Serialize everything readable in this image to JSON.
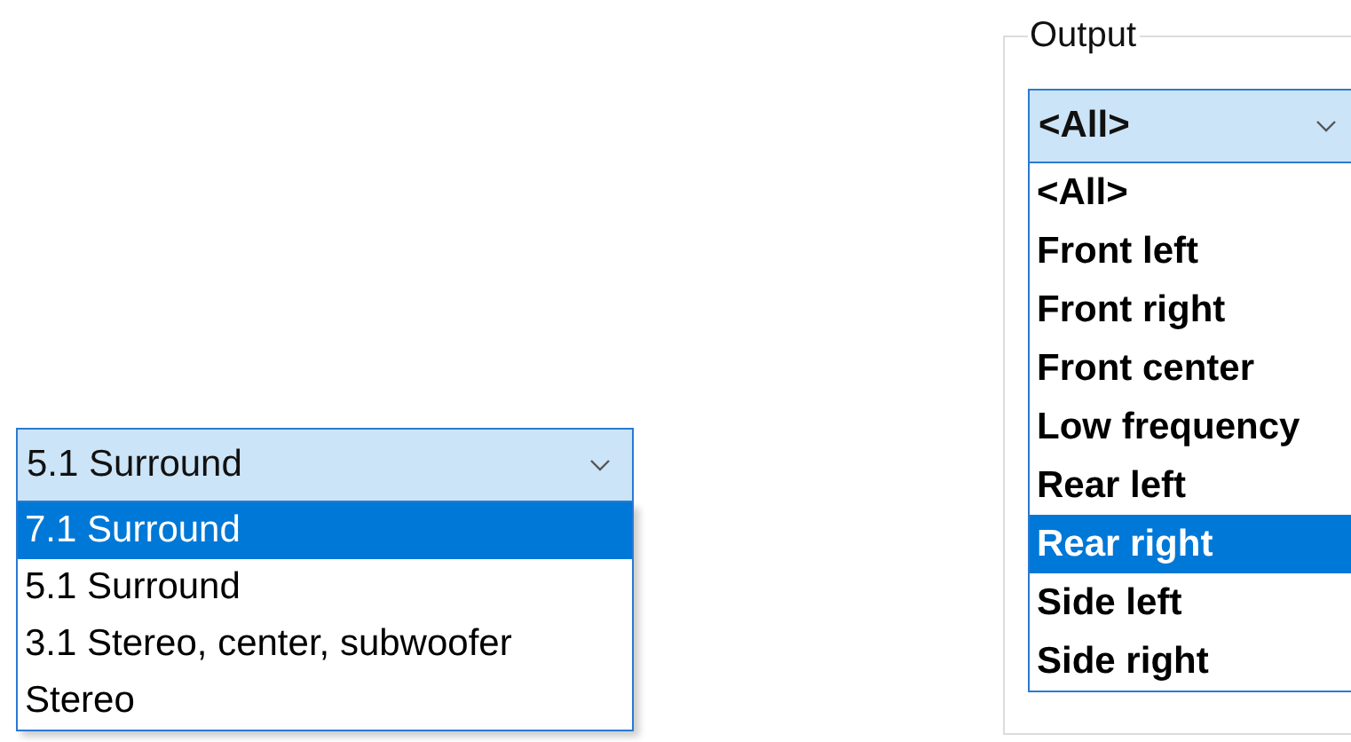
{
  "speaker_setup": {
    "value": "5.1 Surround",
    "options": [
      {
        "label": "7.1 Surround",
        "highlighted": true
      },
      {
        "label": "5.1 Surround",
        "highlighted": false
      },
      {
        "label": "3.1 Stereo, center, subwoofer",
        "highlighted": false
      },
      {
        "label": "Stereo",
        "highlighted": false
      }
    ]
  },
  "output": {
    "title": "Output",
    "value": "<All>",
    "options": [
      {
        "label": "<All>",
        "highlighted": false
      },
      {
        "label": "Front left",
        "highlighted": false
      },
      {
        "label": "Front right",
        "highlighted": false
      },
      {
        "label": "Front center",
        "highlighted": false
      },
      {
        "label": "Low frequency",
        "highlighted": false
      },
      {
        "label": "Rear left",
        "highlighted": false
      },
      {
        "label": "Rear right",
        "highlighted": true
      },
      {
        "label": "Side left",
        "highlighted": false
      },
      {
        "label": "Side right",
        "highlighted": false
      }
    ]
  }
}
